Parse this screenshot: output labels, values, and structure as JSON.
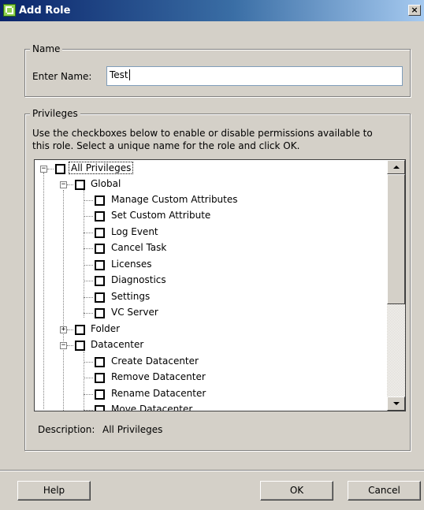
{
  "window": {
    "title": "Add Role",
    "close_label": "×"
  },
  "name_group": {
    "legend": "Name",
    "field_label": "Enter Name:",
    "field_value": "Test"
  },
  "privileges_group": {
    "legend": "Privileges",
    "instructions_line1": "Use the checkboxes below to enable or disable permissions available to",
    "instructions_line2": "this role.  Select a unique name for the role and click OK."
  },
  "tree": {
    "root": "All Privileges",
    "global": "Global",
    "global_items": [
      "Manage Custom Attributes",
      "Set Custom Attribute",
      "Log Event",
      "Cancel Task",
      "Licenses",
      "Diagnostics",
      "Settings",
      "VC Server"
    ],
    "folder": "Folder",
    "datacenter": "Datacenter",
    "datacenter_items": [
      "Create Datacenter",
      "Remove Datacenter",
      "Rename Datacenter",
      "Move Datacenter"
    ]
  },
  "description": {
    "label": "Description:",
    "value": "All Privileges"
  },
  "buttons": {
    "help": "Help",
    "ok": "OK",
    "cancel": "Cancel"
  }
}
